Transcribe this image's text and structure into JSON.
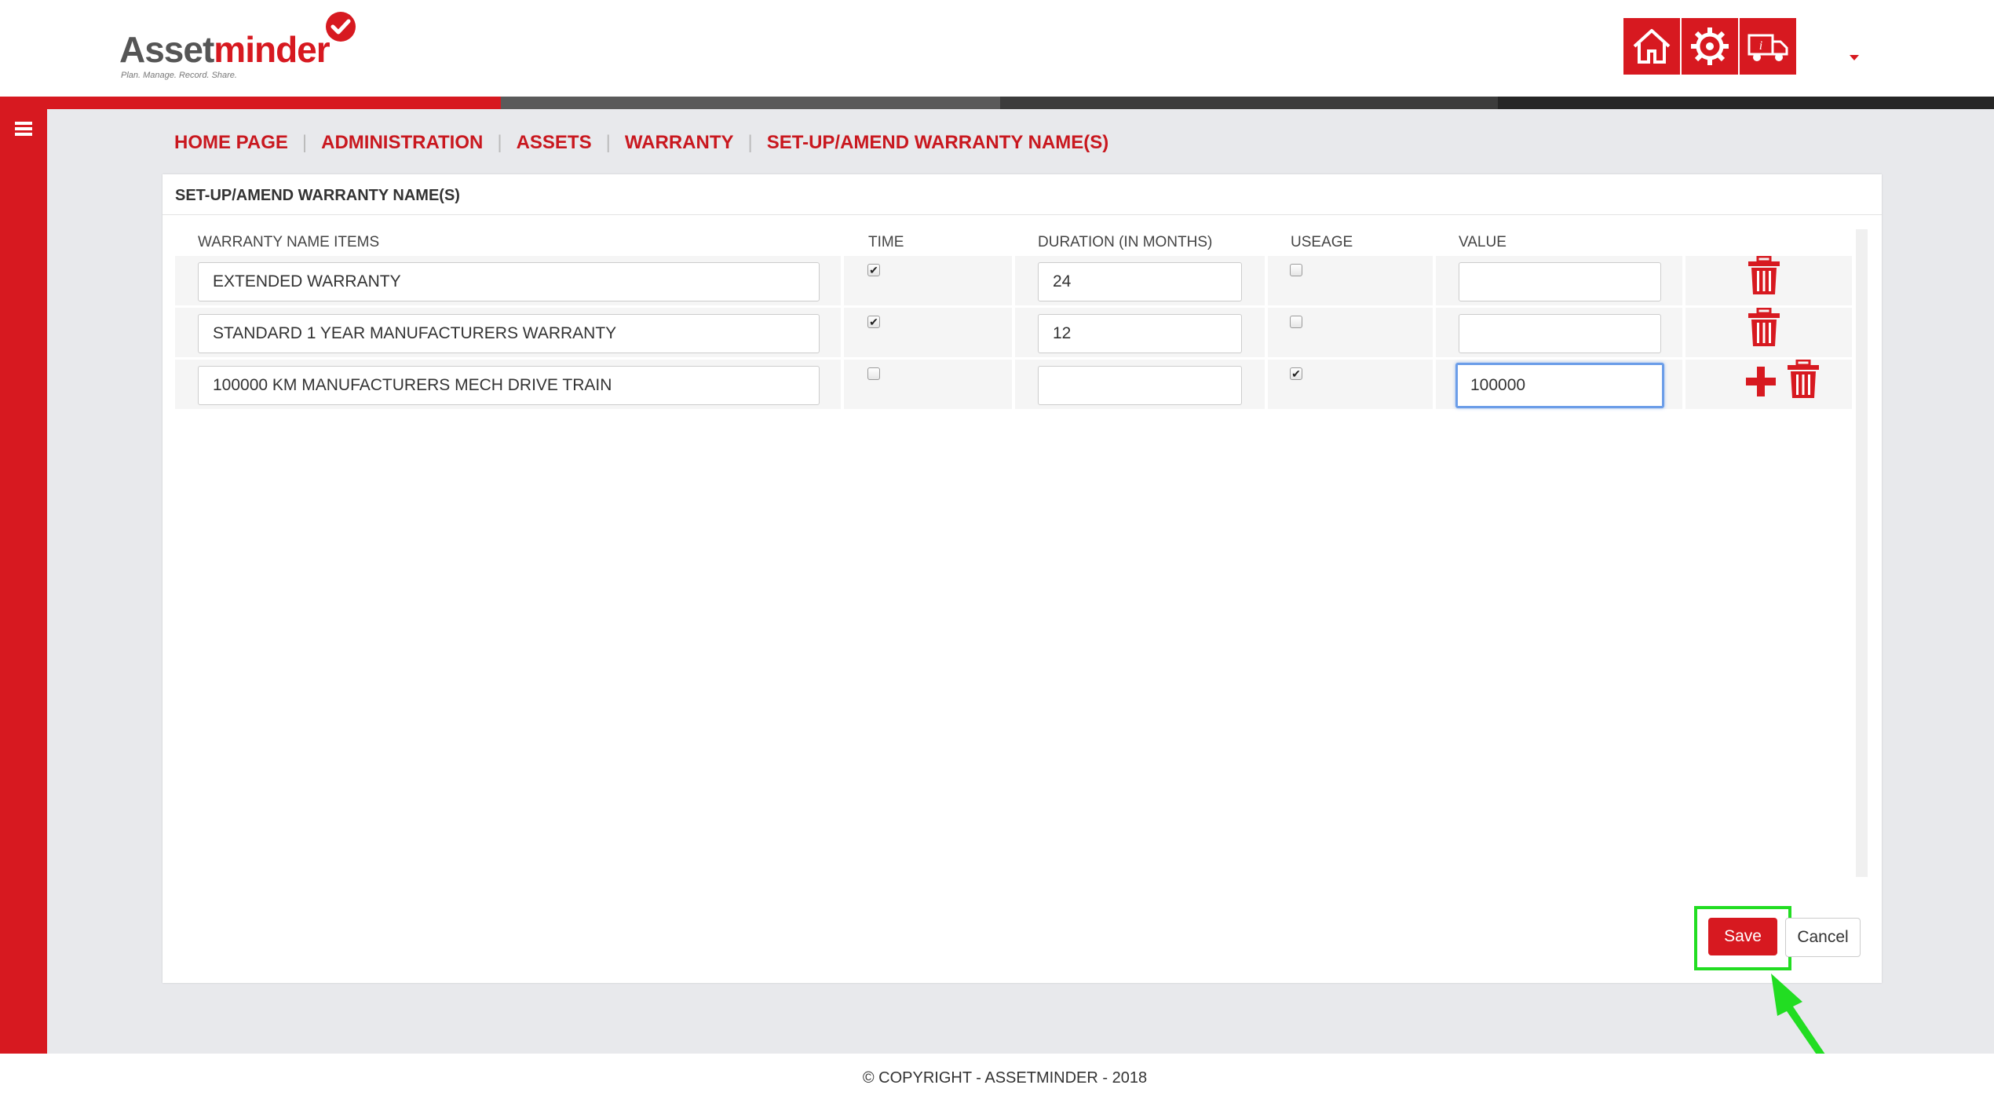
{
  "header": {
    "logo_part1": "Asset",
    "logo_part2": "minder",
    "logo_tagline": "Plan. Manage. Record. Share.",
    "buttons": [
      {
        "name": "home",
        "icon": "home-icon"
      },
      {
        "name": "settings",
        "icon": "gear-icon"
      },
      {
        "name": "vehicle",
        "icon": "truck-icon"
      }
    ],
    "colors": {
      "brand": "#d71920",
      "stripe_gray": "#555555",
      "stripe_dark": "#2a2a2a"
    }
  },
  "sidebar": {
    "menu_icon": "hamburger-icon"
  },
  "breadcrumb": {
    "items": [
      "HOME PAGE",
      "ADMINISTRATION",
      "ASSETS",
      "WARRANTY",
      "SET-UP/AMEND WARRANTY NAME(S)"
    ],
    "separator": "|"
  },
  "panel": {
    "title": "SET-UP/AMEND WARRANTY NAME(S)",
    "columns": [
      "WARRANTY NAME ITEMS",
      "TIME",
      "DURATION (IN MONTHS)",
      "USEAGE",
      "VALUE"
    ],
    "rows": [
      {
        "name": "EXTENDED WARRANTY",
        "time": true,
        "duration": "24",
        "useage": false,
        "value": ""
      },
      {
        "name": "STANDARD 1 YEAR MANUFACTURERS WARRANTY",
        "time": true,
        "duration": "12",
        "useage": false,
        "value": ""
      },
      {
        "name": "100000 KM MANUFACTURERS MECH DRIVE TRAIN",
        "time": false,
        "duration": "",
        "useage": true,
        "value": "100000"
      }
    ]
  },
  "actions": {
    "save_label": "Save",
    "cancel_label": "Cancel"
  },
  "footer": {
    "copyright": "© COPYRIGHT - ASSETMINDER - 2018"
  }
}
